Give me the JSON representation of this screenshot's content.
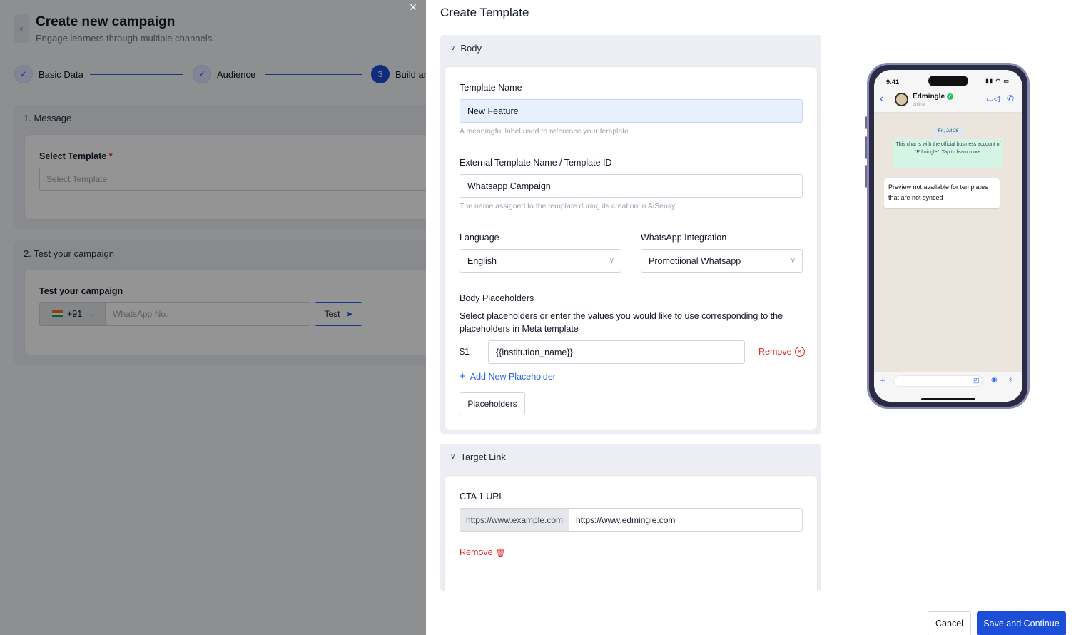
{
  "background": {
    "back_icon": "chevron-left-icon",
    "title": "Create new campaign",
    "subtitle": "Engage learners through multiple channels.",
    "steps": [
      {
        "label": "Basic Data",
        "marker": "✓"
      },
      {
        "label": "Audience",
        "marker": "✓"
      },
      {
        "label": "Build ar",
        "marker": "3"
      }
    ],
    "message_section": {
      "title": "1. Message",
      "select_label": "Select Template",
      "required_mark": "*",
      "select_placeholder": "Select Template"
    },
    "test_section": {
      "title": "2. Test your campaign",
      "label": "Test your campaign",
      "country_code": "+91",
      "phone_placeholder": "WhatsApp No.",
      "test_button": "Test"
    },
    "close_icon": "×"
  },
  "drawer": {
    "title": "Create Template",
    "body_group": {
      "header": "Body",
      "template_name": {
        "label": "Template Name",
        "value": "New Feature",
        "help": "A meaningful label used to reference your template"
      },
      "external_name": {
        "label": "External Template Name / Template ID",
        "value": "Whatsapp Campaign",
        "help": "The name assigned to the template during its creation in AiSensy"
      },
      "language": {
        "label": "Language",
        "value": "English"
      },
      "integration": {
        "label": "WhatsApp Integration",
        "value": "Promotiional Whatsapp"
      },
      "placeholders": {
        "label": "Body Placeholders",
        "description": "Select placeholders or enter the values you would like to use corresponding to the placeholders in Meta template",
        "items": [
          {
            "key": "$1",
            "value": "{{institution_name}}"
          }
        ],
        "remove_label": "Remove",
        "add_label": "Add New Placeholder",
        "button": "Placeholders"
      }
    },
    "target_group": {
      "header": "Target Link",
      "cta_label": "CTA 1 URL",
      "url_prefix": "https://www.example.com",
      "url_value": "https://www.edmingle.com",
      "remove_label": "Remove"
    },
    "footer": {
      "cancel": "Cancel",
      "save": "Save and Continue"
    }
  },
  "preview": {
    "time": "9:41",
    "contact_name": "Edmingle",
    "contact_status": "online",
    "date": "Fri, Jul 26",
    "system_message": "This chat is with the official business account of \"Edmingle\". Tap to learn more.",
    "bubble": "Preview not available for templates that are not synced"
  },
  "colors": {
    "primary": "#1d4ed8",
    "danger": "#dc2626",
    "whatsapp_green": "#22c55e"
  }
}
